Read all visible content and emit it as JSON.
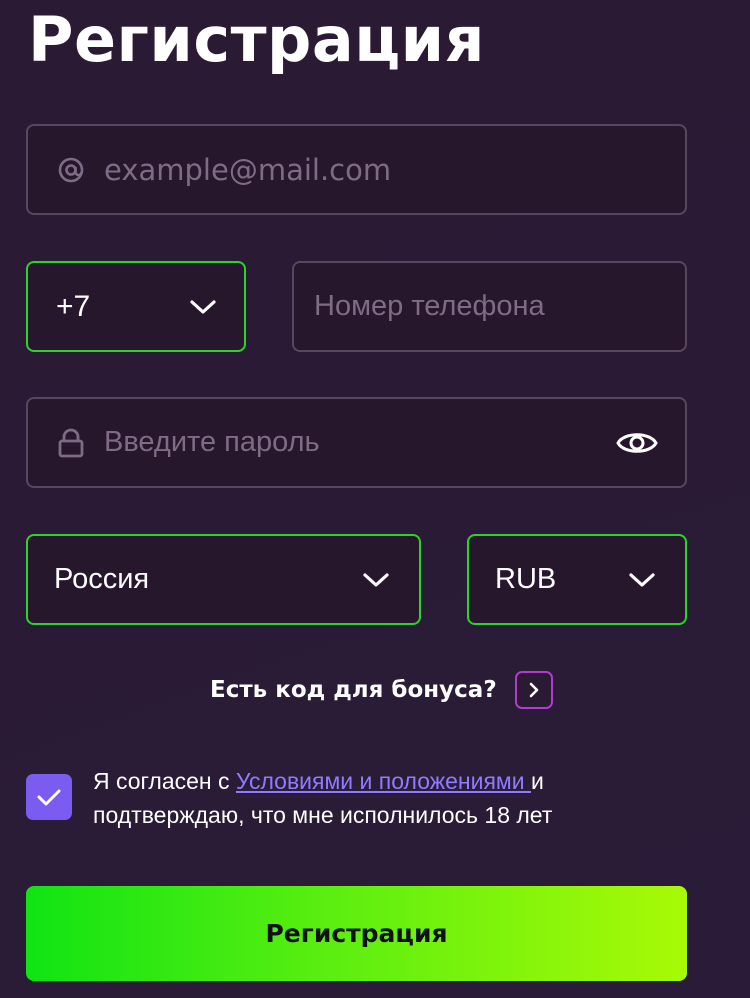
{
  "title": "Регистрация",
  "email": {
    "placeholder": "example@mail.com",
    "icon": "at-icon"
  },
  "phone_code": {
    "value": "+7"
  },
  "phone": {
    "placeholder": "Номер телефона"
  },
  "password": {
    "placeholder": "Введите пароль"
  },
  "country": {
    "value": "Россия"
  },
  "currency": {
    "value": "RUB"
  },
  "bonus": {
    "label": "Есть код для бонуса?"
  },
  "agreement": {
    "checked": true,
    "prefix": "Я согласен с ",
    "link": "Условиями и положениями ",
    "suffix": "и подтверждаю, что мне исполнилось 18 лет"
  },
  "submit": {
    "label": "Регистрация"
  },
  "colors": {
    "accent_green": "#2bd42b",
    "checkbox": "#7b5cf0",
    "link": "#8f7bff",
    "bonus_border": "#b23ad0"
  }
}
